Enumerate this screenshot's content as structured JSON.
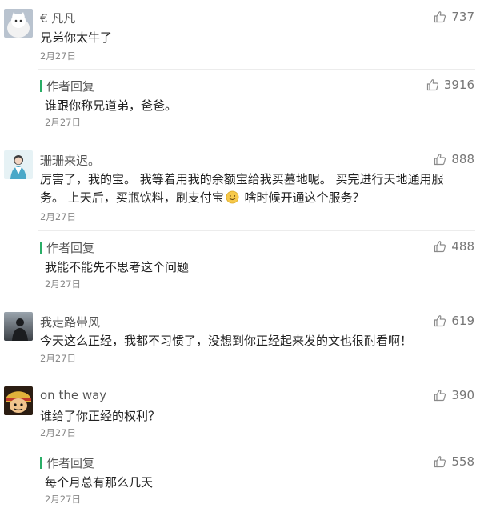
{
  "comments": [
    {
      "user": "€ 凡凡",
      "avatar_icon": "cat-avatar-icon",
      "likes": "737",
      "content": "兄弟你太牛了",
      "date": "2月27日",
      "reply": {
        "tag": "作者回复",
        "likes": "3916",
        "content": "谁跟你称兄道弟，爸爸。",
        "date": "2月27日"
      }
    },
    {
      "user": "珊珊来迟。",
      "avatar_icon": "person-avatar-icon",
      "likes": "888",
      "content_line1": "厉害了，我的宝。 我等着用我的余额宝给我买墓地呢。 买完进行天地通用服",
      "content_line2a": "务。 上天后，买瓶饮料，刷支付宝",
      "content_emoji": "smile-emoji-icon",
      "content_line2b": " 啥时候开通这个服务？",
      "date": "2月27日",
      "reply": {
        "tag": "作者回复",
        "likes": "488",
        "content": "我能不能先不思考这个问题",
        "date": "2月27日"
      }
    },
    {
      "user": "我走路带风",
      "avatar_icon": "silhouette-avatar-icon",
      "likes": "619",
      "content": "今天这么正经，我都不习惯了，没想到你正经起来发的文也很耐看啊！",
      "date": "2月27日"
    },
    {
      "user": "on the way",
      "avatar_icon": "anime-avatar-icon",
      "likes": "390",
      "content": "谁给了你正经的权利？",
      "date": "2月27日",
      "reply": {
        "tag": "作者回复",
        "likes": "558",
        "content": "每个月总有那么几天",
        "date": "2月27日"
      }
    }
  ],
  "colors": {
    "accent": "#2aae67",
    "text": "#222222",
    "meta": "#888888"
  }
}
